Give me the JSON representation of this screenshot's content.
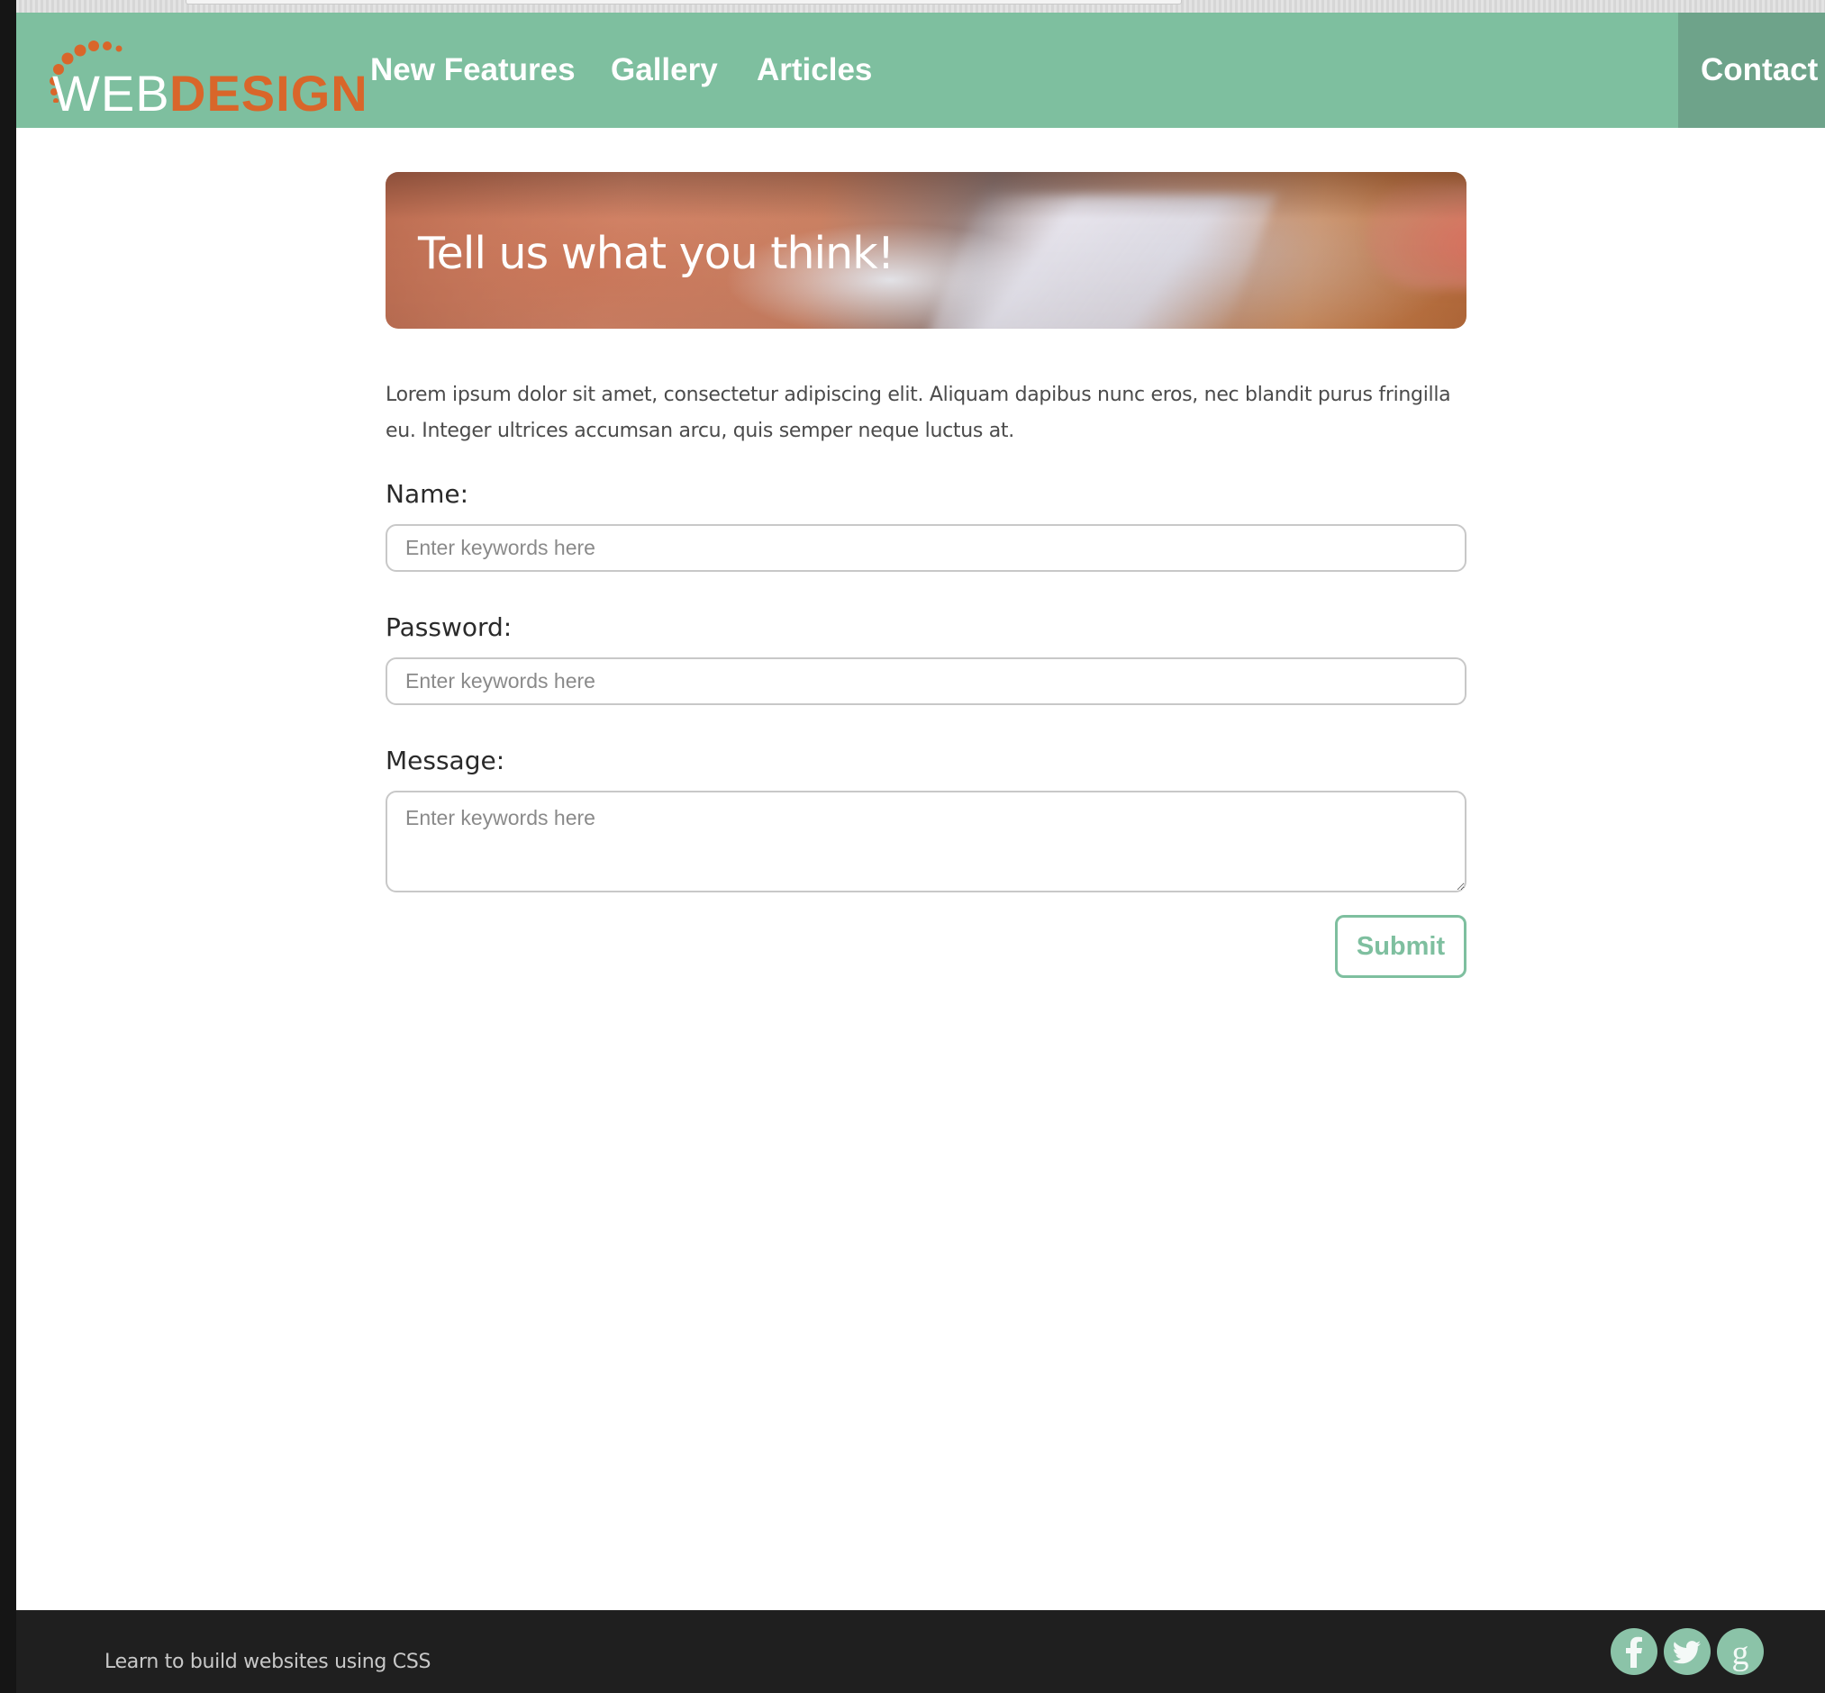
{
  "brand": {
    "name_part1": "WEB",
    "name_part2": "DESIGN",
    "accent_color": "#d9662a"
  },
  "nav": {
    "items": [
      {
        "label": "New Features"
      },
      {
        "label": "Gallery"
      },
      {
        "label": "Articles"
      }
    ],
    "contact_label": "Contact",
    "bar_color": "#7ebf9f",
    "active_color": "#6ea38a"
  },
  "hero": {
    "title": "Tell us what you think!"
  },
  "intro": {
    "text": "Lorem ipsum dolor sit amet, consectetur adipiscing elit. Aliquam dapibus nunc eros, nec blandit purus fringilla eu. Integer ultrices accumsan arcu, quis semper neque luctus at."
  },
  "form": {
    "name_label": "Name:",
    "name_placeholder": "Enter keywords here",
    "password_label": "Password:",
    "password_placeholder": "Enter keywords here",
    "message_label": "Message:",
    "message_placeholder": "Enter keywords here",
    "submit_label": "Submit"
  },
  "footer": {
    "text": "Learn to build websites using CSS",
    "social_icons": [
      "facebook-icon",
      "twitter-icon",
      "google-icon"
    ]
  }
}
